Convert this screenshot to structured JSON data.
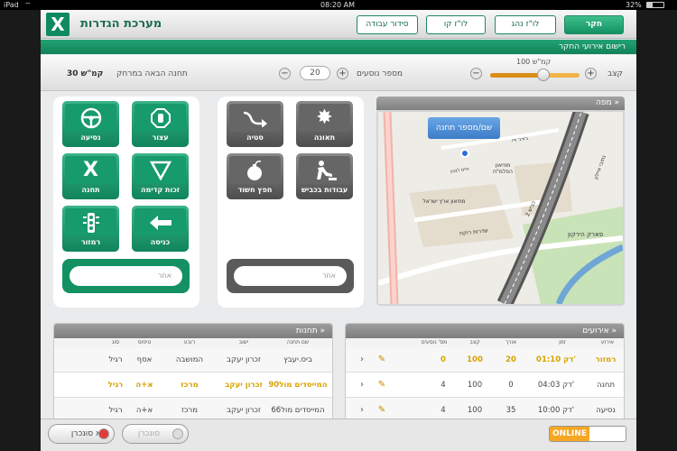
{
  "status_bar": {
    "device": "iPad",
    "time": "08:20 AM",
    "battery": "32%"
  },
  "header": {
    "app_title": "מערכת הגדרות",
    "logo_letter": "X",
    "buttons": [
      "חקר",
      "לו\"ז נהג",
      "לו\"ז קו",
      "סידור עבודה"
    ]
  },
  "subheader": {
    "title": "רישום אירועי החקר"
  },
  "controls": {
    "speed_label": "קצב",
    "speed_value": "100 קמ\"ש",
    "speed_fraction": 0.6,
    "passengers_label": "מספר נוסעים",
    "passengers_value": "20",
    "next_station_label": "תחנה הבאה במרחק",
    "next_station_value": "30 קמ\"ש"
  },
  "event_buttons_green": [
    "עצור",
    "נסיעה",
    "זכות קדימה",
    "תחנה",
    "כניסה",
    "רמזור"
  ],
  "event_buttons_dark": [
    "תאונה",
    "סטיה",
    "עבודות בכביש",
    "חפץ חשוד"
  ],
  "search": {
    "placeholder": "אחר"
  },
  "map": {
    "title": "מפה",
    "callout": "שם/מספר תחנה",
    "labels": [
      "מוזיאון הפלמ\"ח",
      "מוזיאון ארץ ישראל",
      "פארק הירקון",
      "שדרות רוקח",
      "נתיבי איילון",
      "כביש 2",
      "ג'ורג' וייז",
      "חיים לבנון"
    ]
  },
  "events_table": {
    "title": "אירועים",
    "columns": [
      "אירוע",
      "זמן",
      "אורך",
      "קצב",
      "מס' נוסעים"
    ],
    "rows": [
      {
        "event": "רמזור",
        "time": "01:10 דק'",
        "length": "20",
        "speed": "100",
        "passengers": "0",
        "hl": true
      },
      {
        "event": "תחנה",
        "time": "04:03 דק'",
        "length": "0",
        "speed": "100",
        "passengers": "4",
        "hl": false
      },
      {
        "event": "נסיעה",
        "time": "10:00 דק'",
        "length": "35",
        "speed": "100",
        "passengers": "4",
        "hl": false
      }
    ]
  },
  "stations_table": {
    "title": "תחנות",
    "columns": [
      "שם תחנה",
      "ישוב",
      "רובע",
      "טיפוס",
      "סוג"
    ],
    "rows": [
      {
        "name": "ביס.יעבץ",
        "city": "זכרון יעקב",
        "area": "המושבה",
        "type": "אסף",
        "kind": "רגיל",
        "hl": false
      },
      {
        "name": "המייסדים מול90",
        "city": "זכרון יעקב",
        "area": "מרכז",
        "type": "א+ה",
        "kind": "רגיל",
        "hl": true
      },
      {
        "name": "המייסדים מול66",
        "city": "זכרון יעקב",
        "area": "מרכז",
        "type": "א+ה",
        "kind": "רגיל",
        "hl": false
      }
    ]
  },
  "footer": {
    "online": "ONLINE",
    "sync": "סונכרן",
    "no_sync": "לא סונכרן"
  },
  "colors": {
    "primary_green": "#139163",
    "accent_orange": "#f5a623",
    "highlight_yellow": "#d6a300"
  }
}
